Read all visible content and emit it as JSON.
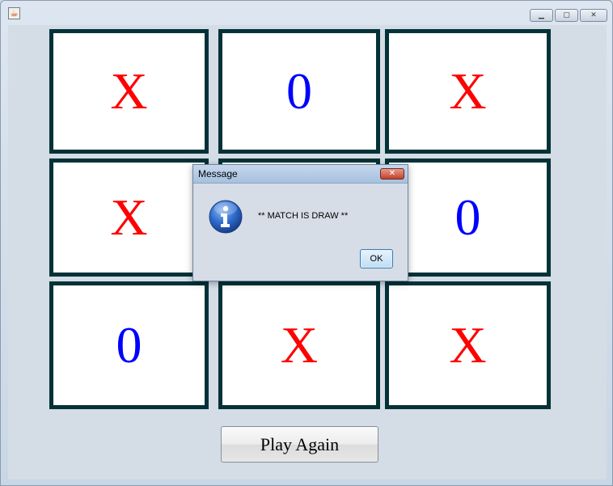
{
  "window": {
    "icon": "java-cup-icon",
    "controls": {
      "minimize_icon": "minimize-icon",
      "maximize_icon": "maximize-icon",
      "close_icon": "close-icon"
    }
  },
  "board": {
    "cells": [
      "X",
      "0",
      "X",
      "X",
      "",
      "0",
      "0",
      "X",
      "X"
    ],
    "colors": {
      "x": "#ff0000",
      "o": "#0000ff",
      "border": "#023237"
    }
  },
  "play_again_label": "Play Again",
  "dialog": {
    "title": "Message",
    "message": "** MATCH IS DRAW **",
    "ok_label": "OK",
    "icon": "info-icon"
  }
}
